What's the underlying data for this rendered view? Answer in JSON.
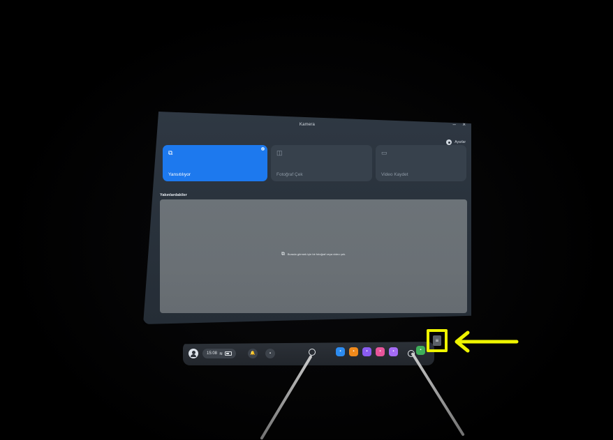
{
  "window": {
    "title": "Kamera",
    "minimize_label": "–",
    "close_label": "×",
    "settings_label": "Ayarlar",
    "modes": [
      {
        "label": "Yansıtılıyor",
        "icon": "cast-icon",
        "glyph": "⧉",
        "active": true
      },
      {
        "label": "Fotoğraf Çek",
        "icon": "camera-icon",
        "glyph": "◫",
        "active": false
      },
      {
        "label": "Video Kaydet",
        "icon": "video-icon",
        "glyph": "▭",
        "active": false
      }
    ],
    "recent_label": "Yakınlardakiler",
    "empty_message": "Burada görmek için bir fotoğraf veya video çek.",
    "empty_icon": "photos-icon"
  },
  "taskbar": {
    "time": "15:08",
    "wifi_glyph": "≋",
    "notify_glyph": "🔔",
    "chat_glyph": "▪",
    "apps": [
      {
        "name": "app-store-icon",
        "color": "#2d8cf0",
        "glyph": "▪"
      },
      {
        "name": "folder-app-icon",
        "color": "#f08a1c",
        "glyph": "▪"
      },
      {
        "name": "people-app-icon",
        "color": "#8a5cf0",
        "glyph": "▪"
      },
      {
        "name": "photos-app-icon",
        "color": "#e8559a",
        "glyph": "▪"
      },
      {
        "name": "browser-app-icon",
        "color": "#a56cf5",
        "glyph": "▪"
      },
      {
        "name": "settings-app-icon",
        "color": "#4aa0ff",
        "glyph": "▪"
      },
      {
        "name": "green-app-icon",
        "color": "#3fae5a",
        "glyph": "▪"
      }
    ],
    "library_glyph": "≡"
  },
  "annotation": {
    "highlight_color": "#eef400",
    "arrow_color": "#eef400"
  }
}
